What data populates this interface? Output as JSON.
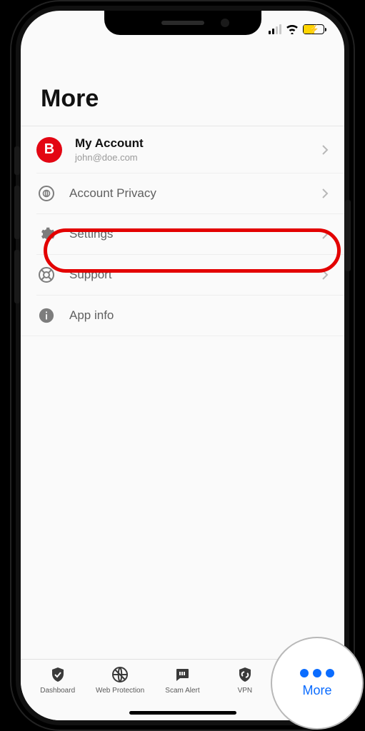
{
  "header": {
    "title": "More"
  },
  "account": {
    "avatar_letter": "B",
    "title": "My Account",
    "email": "john@doe.com"
  },
  "menu": {
    "privacy": "Account Privacy",
    "settings": "Settings",
    "support": "Support",
    "appinfo": "App info"
  },
  "tabs": {
    "dashboard": "Dashboard",
    "web": "Web Protection",
    "scam": "Scam Alert",
    "vpn": "VPN",
    "more": "More"
  },
  "annotation": {
    "more_label": "More"
  },
  "colors": {
    "brand_red": "#e30613",
    "accent_blue": "#0a6cff",
    "highlight_red": "#e30000"
  }
}
